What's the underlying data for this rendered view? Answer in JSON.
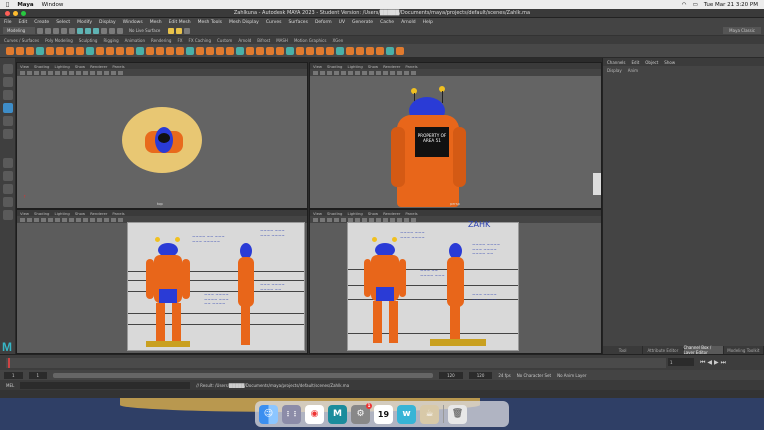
{
  "mac_menu": {
    "apple": "",
    "app": "Maya",
    "window": "Window",
    "clock": "Tue Mar 21 3:20 PM"
  },
  "window": {
    "title": "Zahlkuna - Autodesk MAYA 2023 - Student Version: /Users/█████/Documents/maya/projects/default/scenes/Zahlk.ma"
  },
  "maya_menus": [
    "File",
    "Edit",
    "Create",
    "Select",
    "Modify",
    "Display",
    "Windows",
    "Mesh",
    "Edit Mesh",
    "Mesh Tools",
    "Mesh Display",
    "Curves",
    "Surfaces",
    "Deform",
    "UV",
    "Generate",
    "Cache",
    "Arnold",
    "Help"
  ],
  "status": {
    "mode": "Modeling",
    "live": "No Live Surface",
    "workspace": "Maya Classic"
  },
  "shelf_tabs": [
    "Curves / Surfaces",
    "Poly Modeling",
    "Sculpting",
    "Rigging",
    "Animation",
    "Rendering",
    "FX",
    "FX Caching",
    "Custom",
    "Arnold",
    "Bifrost",
    "MASH",
    "Motion Graphics",
    "XGen"
  ],
  "viewport_menu": [
    "View",
    "Shading",
    "Lighting",
    "Show",
    "Renderer",
    "Panels"
  ],
  "viewports": [
    {
      "name": "top",
      "label": "top"
    },
    {
      "name": "persp",
      "label": "persp"
    },
    {
      "name": "front",
      "label": ""
    },
    {
      "name": "side",
      "label": ""
    }
  ],
  "robot_sign": "PROPERTY OF AREA 51",
  "sheet_title": "ZAHK",
  "channel_box": {
    "tabs": [
      "Channels",
      "Edit",
      "Object",
      "Show"
    ],
    "sub": [
      "Display",
      "Anim"
    ],
    "bottom_tabs": [
      "Tool",
      "Attribute Editor",
      "Channel Box / Layer Editor",
      "Modeling Toolkit"
    ]
  },
  "time": {
    "start": "1",
    "end": "120",
    "current": "1",
    "range_start": "1",
    "range_end": "120",
    "fps": "24 fps",
    "char_set": "No Character Set",
    "anim_layer": "No Anim Layer"
  },
  "cmdline": {
    "lang": "MEL",
    "result": "// Result: /Users/█████/Documents/maya/projects/default/scenes/Zahlk.ma"
  },
  "dock": [
    "Finder",
    "Launchpad",
    "Chrome",
    "Maya",
    "Settings",
    "Calendar",
    "Word",
    "Preview",
    "Trash"
  ],
  "calendar_day": "19",
  "settings_badge": "1"
}
